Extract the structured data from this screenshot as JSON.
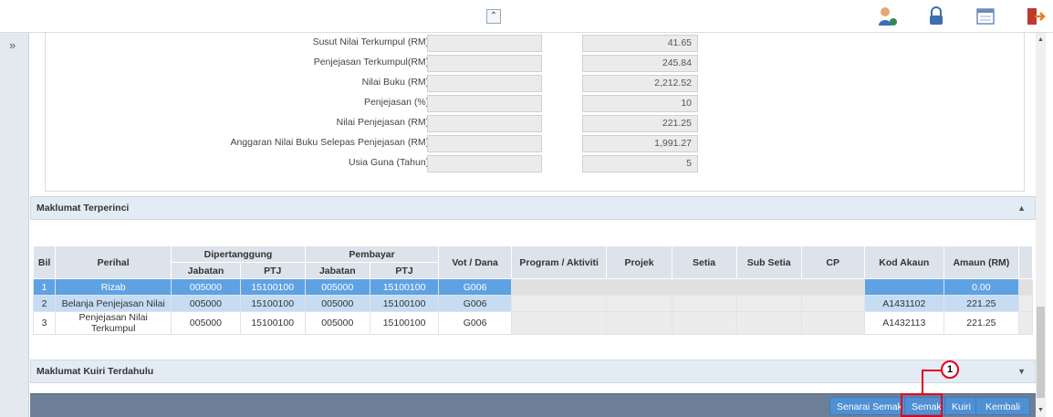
{
  "asset_fields": [
    {
      "label": "Susut Nilai Terkumpul (RM) :",
      "value": "41.65"
    },
    {
      "label": "Penjejasan Terkumpul(RM) :",
      "value": "245.84"
    },
    {
      "label": "Nilai Buku (RM) :",
      "value": "2,212.52"
    },
    {
      "label": "Penjejasan (%) :",
      "value": "10"
    },
    {
      "label": "Nilai Penjejasan (RM) :",
      "value": "221.25"
    },
    {
      "label": "Anggaran Nilai Buku Selepas Penjejasan (RM) :",
      "value": "1,991.27"
    },
    {
      "label": "Usia Guna (Tahun) :",
      "value": "5"
    }
  ],
  "sections": {
    "detail_title": "Maklumat Terperinci",
    "prev_query_title": "Maklumat Kuiri Terdahulu"
  },
  "table": {
    "headers": {
      "bil": "Bil",
      "perihal": "Perihal",
      "dipertanggung": "Dipertanggung",
      "pembayar": "Pembayar",
      "jabatan1": "Jabatan",
      "ptj1": "PTJ",
      "jabatan2": "Jabatan",
      "ptj2": "PTJ",
      "vot": "Vot / Dana",
      "program": "Program / Aktiviti",
      "projek": "Projek",
      "setia": "Setia",
      "subsetia": "Sub Setia",
      "cp": "CP",
      "kod": "Kod Akaun",
      "amaun": "Amaun (RM)"
    },
    "rows": [
      {
        "bil": "1",
        "perihal": "Rizab",
        "jab1": "005000",
        "ptj1": "15100100",
        "jab2": "005000",
        "ptj2": "15100100",
        "vot": "G006",
        "kod": "",
        "amaun": "0.00"
      },
      {
        "bil": "2",
        "perihal": "Belanja Penjejasan Nilai",
        "jab1": "005000",
        "ptj1": "15100100",
        "jab2": "005000",
        "ptj2": "15100100",
        "vot": "G006",
        "kod": "A1431102",
        "amaun": "221.25"
      },
      {
        "bil": "3",
        "perihal": "Penjejasan Nilai Terkumpul",
        "jab1": "005000",
        "ptj1": "15100100",
        "jab2": "005000",
        "ptj2": "15100100",
        "vot": "G006",
        "kod": "A1432113",
        "amaun": "221.25"
      }
    ]
  },
  "buttons": {
    "senarai_semak": "Senarai Semak",
    "semak": "Semak",
    "kuiri": "Kuiri",
    "kembali": "Kembali"
  },
  "callout": {
    "number": "1"
  },
  "icons": {
    "collapse": "double-chevron-up-icon",
    "sidebar": "double-chevron-right-icon",
    "user": "user-icon",
    "lock": "lock-icon",
    "window": "window-icon",
    "logout": "logout-icon"
  },
  "colors": {
    "selected_row": "#5fa2e3",
    "alt_row": "#c5dcf3",
    "bottom_bar": "#6d7f96",
    "button": "#4f8fd3",
    "highlight": "#e0001b"
  }
}
